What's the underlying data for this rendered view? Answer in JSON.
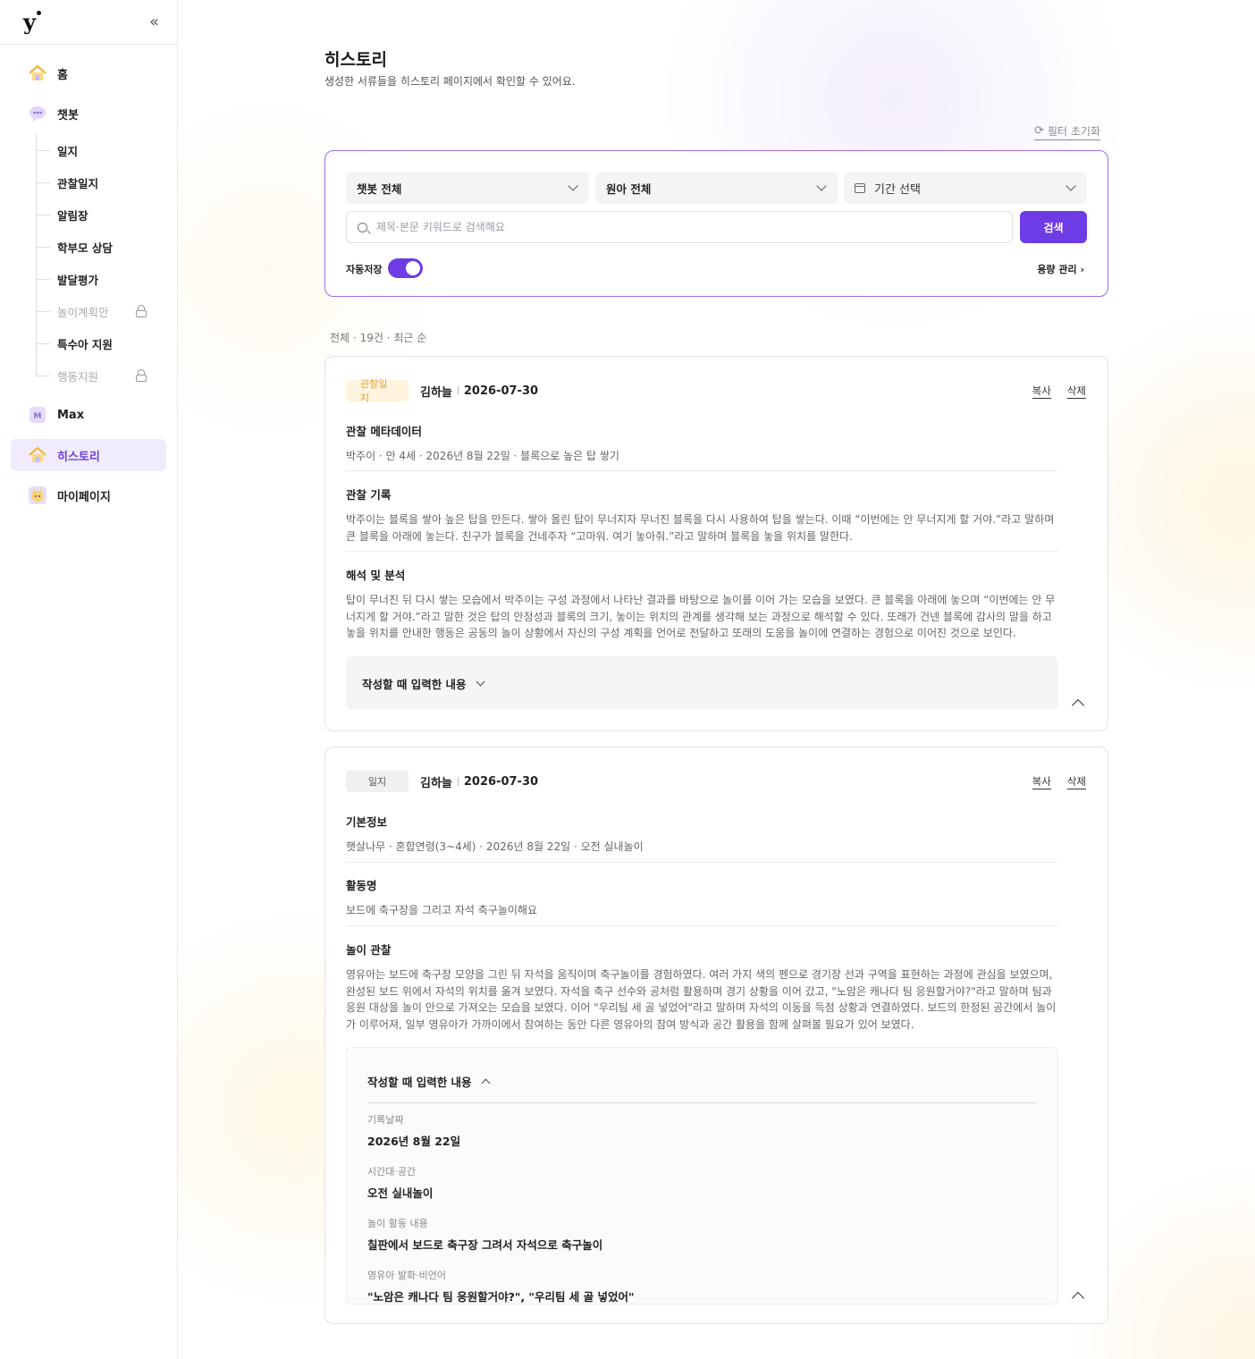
{
  "sidebar": {
    "logo": "y",
    "collapse_icon": "«",
    "items": {
      "home": "홈",
      "chatbot": "챗봇",
      "max": "Max",
      "history": "히스토리",
      "mypage": "마이페이지"
    },
    "sub_items": [
      "일지",
      "관찰일지",
      "알림장",
      "학부모 상담",
      "발달평가",
      "놀이계획안",
      "특수아 지원",
      "행동지원"
    ],
    "locked_sub_items": [
      "놀이계획안",
      "행동지원"
    ],
    "active_item": "히스토리",
    "accent_color": "#6d3ce4"
  },
  "page": {
    "title": "히스토리",
    "subtitle": "생성한 서류들을 히스토리 페이지에서 확인할 수 있어요.",
    "reset_filter": "필터 초기화"
  },
  "filters": {
    "chatbot_select": "챗봇 전체",
    "child_select": "원아 전체",
    "period_select": "기간 선택",
    "search_placeholder": "제목·본문 키워드로 검색해요",
    "search_value": "",
    "search_button": "검색",
    "autosave_label": "자동저장",
    "autosave_on": true,
    "capacity_link": "용량 관리 ›"
  },
  "list": {
    "filter_all": "전체",
    "count": "19건",
    "sort": "최근 순"
  },
  "cards": [
    {
      "tag": "관찰일지",
      "author": "김하늘",
      "date": "2026-07-30",
      "copy": "복사",
      "delete": "삭제",
      "sections": [
        {
          "title": "관찰 메타데이터",
          "body": "박주이 · 만 4세 · 2026년 8월 22일 · 블록으로 높은 탑 쌓기"
        },
        {
          "title": "관찰 기록",
          "body": "박주이는 블록을 쌓아 높은 탑을 만든다. 쌓아 올린 탑이 무너지자 무너진 블록을 다시 사용하여 탑을 쌓는다. 이때 “이번에는 안 무너지게 할 거야.”라고 말하며 큰 블록을 아래에 놓는다. 친구가 블록을 건네주자 “고마워. 여기 놓아줘.”라고 말하며 블록을 놓을 위치를 말한다."
        },
        {
          "title": "해석 및 분석",
          "body": "탑이 무너진 뒤 다시 쌓는 모습에서 박주이는 구성 과정에서 나타난 결과를 바탕으로 놀이를 이어 가는 모습을 보였다. 큰 블록을 아래에 놓으며 “이번에는 안 무너지게 할 거야.”라고 말한 것은 탑의 안정성과 블록의 크기, 놓이는 위치의 관계를 생각해 보는 과정으로 해석할 수 있다. 또래가 건넨 블록에 감사의 말을 하고 놓을 위치를 안내한 행동은 공동의 놀이 상황에서 자신의 구성 계획을 언어로 전달하고 또래의 도움을 놀이에 연결하는 경험으로 이어진 것으로 보인다."
        }
      ],
      "input_panel_title": "작성할 때 입력한 내용"
    },
    {
      "tag": "일지",
      "author": "김하늘",
      "date": "2026-07-30",
      "copy": "복사",
      "delete": "삭제",
      "sections": [
        {
          "title": "기본정보",
          "body": "햇살나무 · 혼합연령(3~4세) · 2026년 8월 22일 · 오전 실내놀이"
        },
        {
          "title": "활동명",
          "body": "보드에 축구장을 그리고 자석 축구놀이해요"
        },
        {
          "title": "놀이 관찰",
          "body": "영유아는 보드에 축구장 모양을 그린 뒤 자석을 움직이며 축구놀이를 경험하였다. 여러 가지 색의 펜으로 경기장 선과 구역을 표현하는 과정에 관심을 보였으며, 완성된 보드 위에서 자석의 위치를 옮겨 보였다. 자석을 축구 선수와 공처럼 활용하며 경기 상황을 이어 갔고, \"노암은 캐나다 팀 응원할거야?\"라고 말하며 팀과 응원 대상을 놀이 안으로 가져오는 모습을 보였다. 이어 \"우리팀 세 골 넣었어\"라고 말하며 자석의 이동을 득점 상황과 연결하였다. 보드의 한정된 공간에서 놀이가 이루어져, 일부 영유아가 가까이에서 참여하는 동안 다른 영유아의 참여 방식과 공간 활용을 함께 살펴볼 필요가 있어 보였다."
        }
      ],
      "input_panel_title": "작성할 때 입력한 내용",
      "input_fields": [
        {
          "label": "기록날짜",
          "value": "2026년 8월 22일"
        },
        {
          "label": "시간대·공간",
          "value": "오전 실내놀이"
        },
        {
          "label": "놀이 활동 내용",
          "value": "칠판에서 보드로 축구장 그려서 자석으로 축구놀이"
        },
        {
          "label": "영유아 발화·비언어",
          "value": "\"노암은 캐나다 팀 응원할거야?\", \"우리팀 세 골 넣었어\""
        }
      ]
    }
  ]
}
